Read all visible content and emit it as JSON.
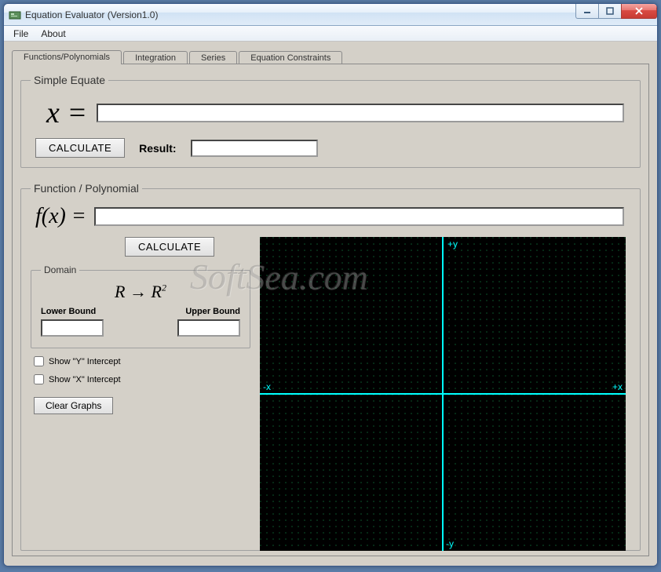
{
  "window": {
    "title": "Equation Evaluator (Version1.0)"
  },
  "menubar": {
    "file": "File",
    "about": "About"
  },
  "tabs": {
    "functions": "Functions/Polynomials",
    "integration": "Integration",
    "series": "Series",
    "constraints": "Equation Constraints"
  },
  "simple": {
    "legend": "Simple Equate",
    "xeq": "x =",
    "value": "",
    "calculate": "CALCULATE",
    "result_label": "Result:",
    "result_value": ""
  },
  "func": {
    "legend": "Function / Polynomial",
    "fxlab": "f(x) =",
    "value": "",
    "calculate": "CALCULATE",
    "domain": {
      "legend": "Domain",
      "rr2": "R → R²",
      "lower_label": "Lower Bound",
      "upper_label": "Upper Bound",
      "lower_value": "",
      "upper_value": ""
    },
    "show_y": "Show \"Y\" Intercept",
    "show_x": "Show \"X\" Intercept",
    "clear": "Clear Graphs",
    "axes": {
      "py": "+y",
      "ny": "-y",
      "px": "+x",
      "nx": "-x"
    }
  },
  "watermark": "SoftSea.com"
}
